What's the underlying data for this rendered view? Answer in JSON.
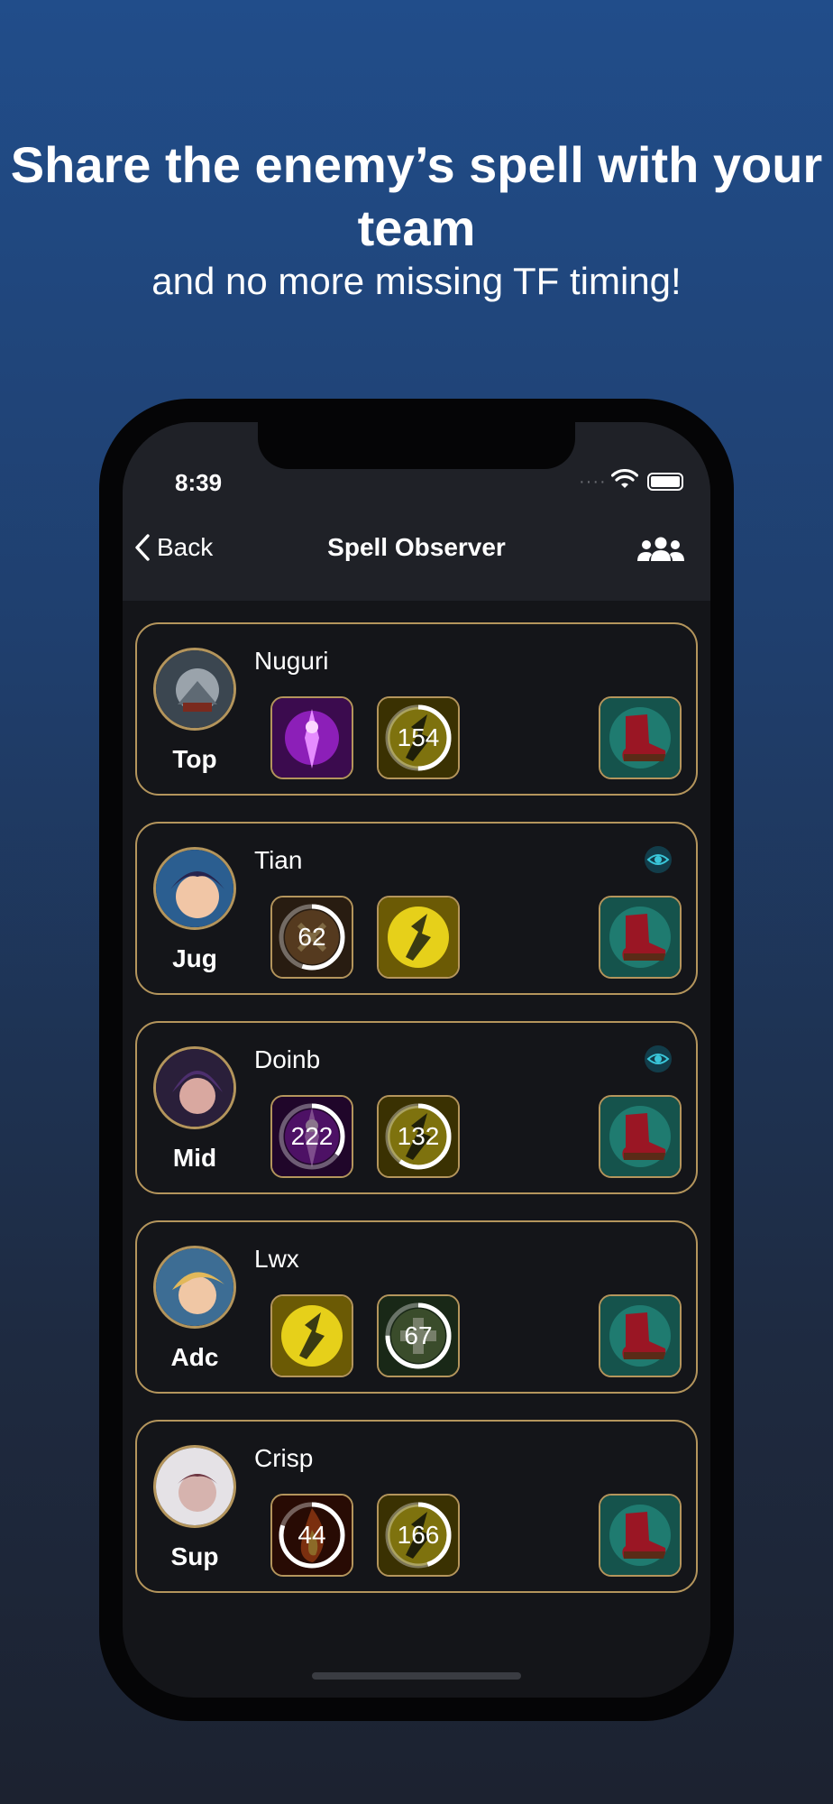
{
  "headline": "Share the enemy’s spell with your team",
  "subline": "and no more missing TF timing!",
  "status": {
    "time": "8:39"
  },
  "nav": {
    "back_label": "Back",
    "title": "Spell Observer",
    "team_icon": "group-icon"
  },
  "colors": {
    "accent": "#b4955c",
    "background": "#141519",
    "bar": "#1f2127",
    "ring": "#ffffff"
  },
  "players": [
    {
      "name": "Nuguri",
      "role": "Top",
      "observed": false,
      "spells": [
        {
          "icon": "teleport-spell-icon",
          "cooldown": "",
          "progress": 0
        },
        {
          "icon": "flash-spell-icon",
          "cooldown": "154",
          "progress": 0.5
        }
      ],
      "item": "boots-item-icon"
    },
    {
      "name": "Tian",
      "role": "Jug",
      "observed": true,
      "spells": [
        {
          "icon": "smite-spell-icon",
          "cooldown": "62",
          "progress": 0.45
        },
        {
          "icon": "flash-spell-icon",
          "cooldown": "",
          "progress": 0
        }
      ],
      "item": "boots-item-icon"
    },
    {
      "name": "Doinb",
      "role": "Mid",
      "observed": true,
      "spells": [
        {
          "icon": "teleport-spell-icon",
          "cooldown": "222",
          "progress": 0.65
        },
        {
          "icon": "flash-spell-icon",
          "cooldown": "132",
          "progress": 0.4
        }
      ],
      "item": "boots-item-icon"
    },
    {
      "name": "Lwx",
      "role": "Adc",
      "observed": false,
      "spells": [
        {
          "icon": "flash-spell-icon",
          "cooldown": "",
          "progress": 0
        },
        {
          "icon": "heal-spell-icon",
          "cooldown": "67",
          "progress": 0.25
        }
      ],
      "item": "boots-item-icon"
    },
    {
      "name": "Crisp",
      "role": "Sup",
      "observed": false,
      "spells": [
        {
          "icon": "ignite-spell-icon",
          "cooldown": "44",
          "progress": 0.2
        },
        {
          "icon": "flash-spell-icon",
          "cooldown": "166",
          "progress": 0.55
        }
      ],
      "item": "boots-item-icon"
    }
  ]
}
